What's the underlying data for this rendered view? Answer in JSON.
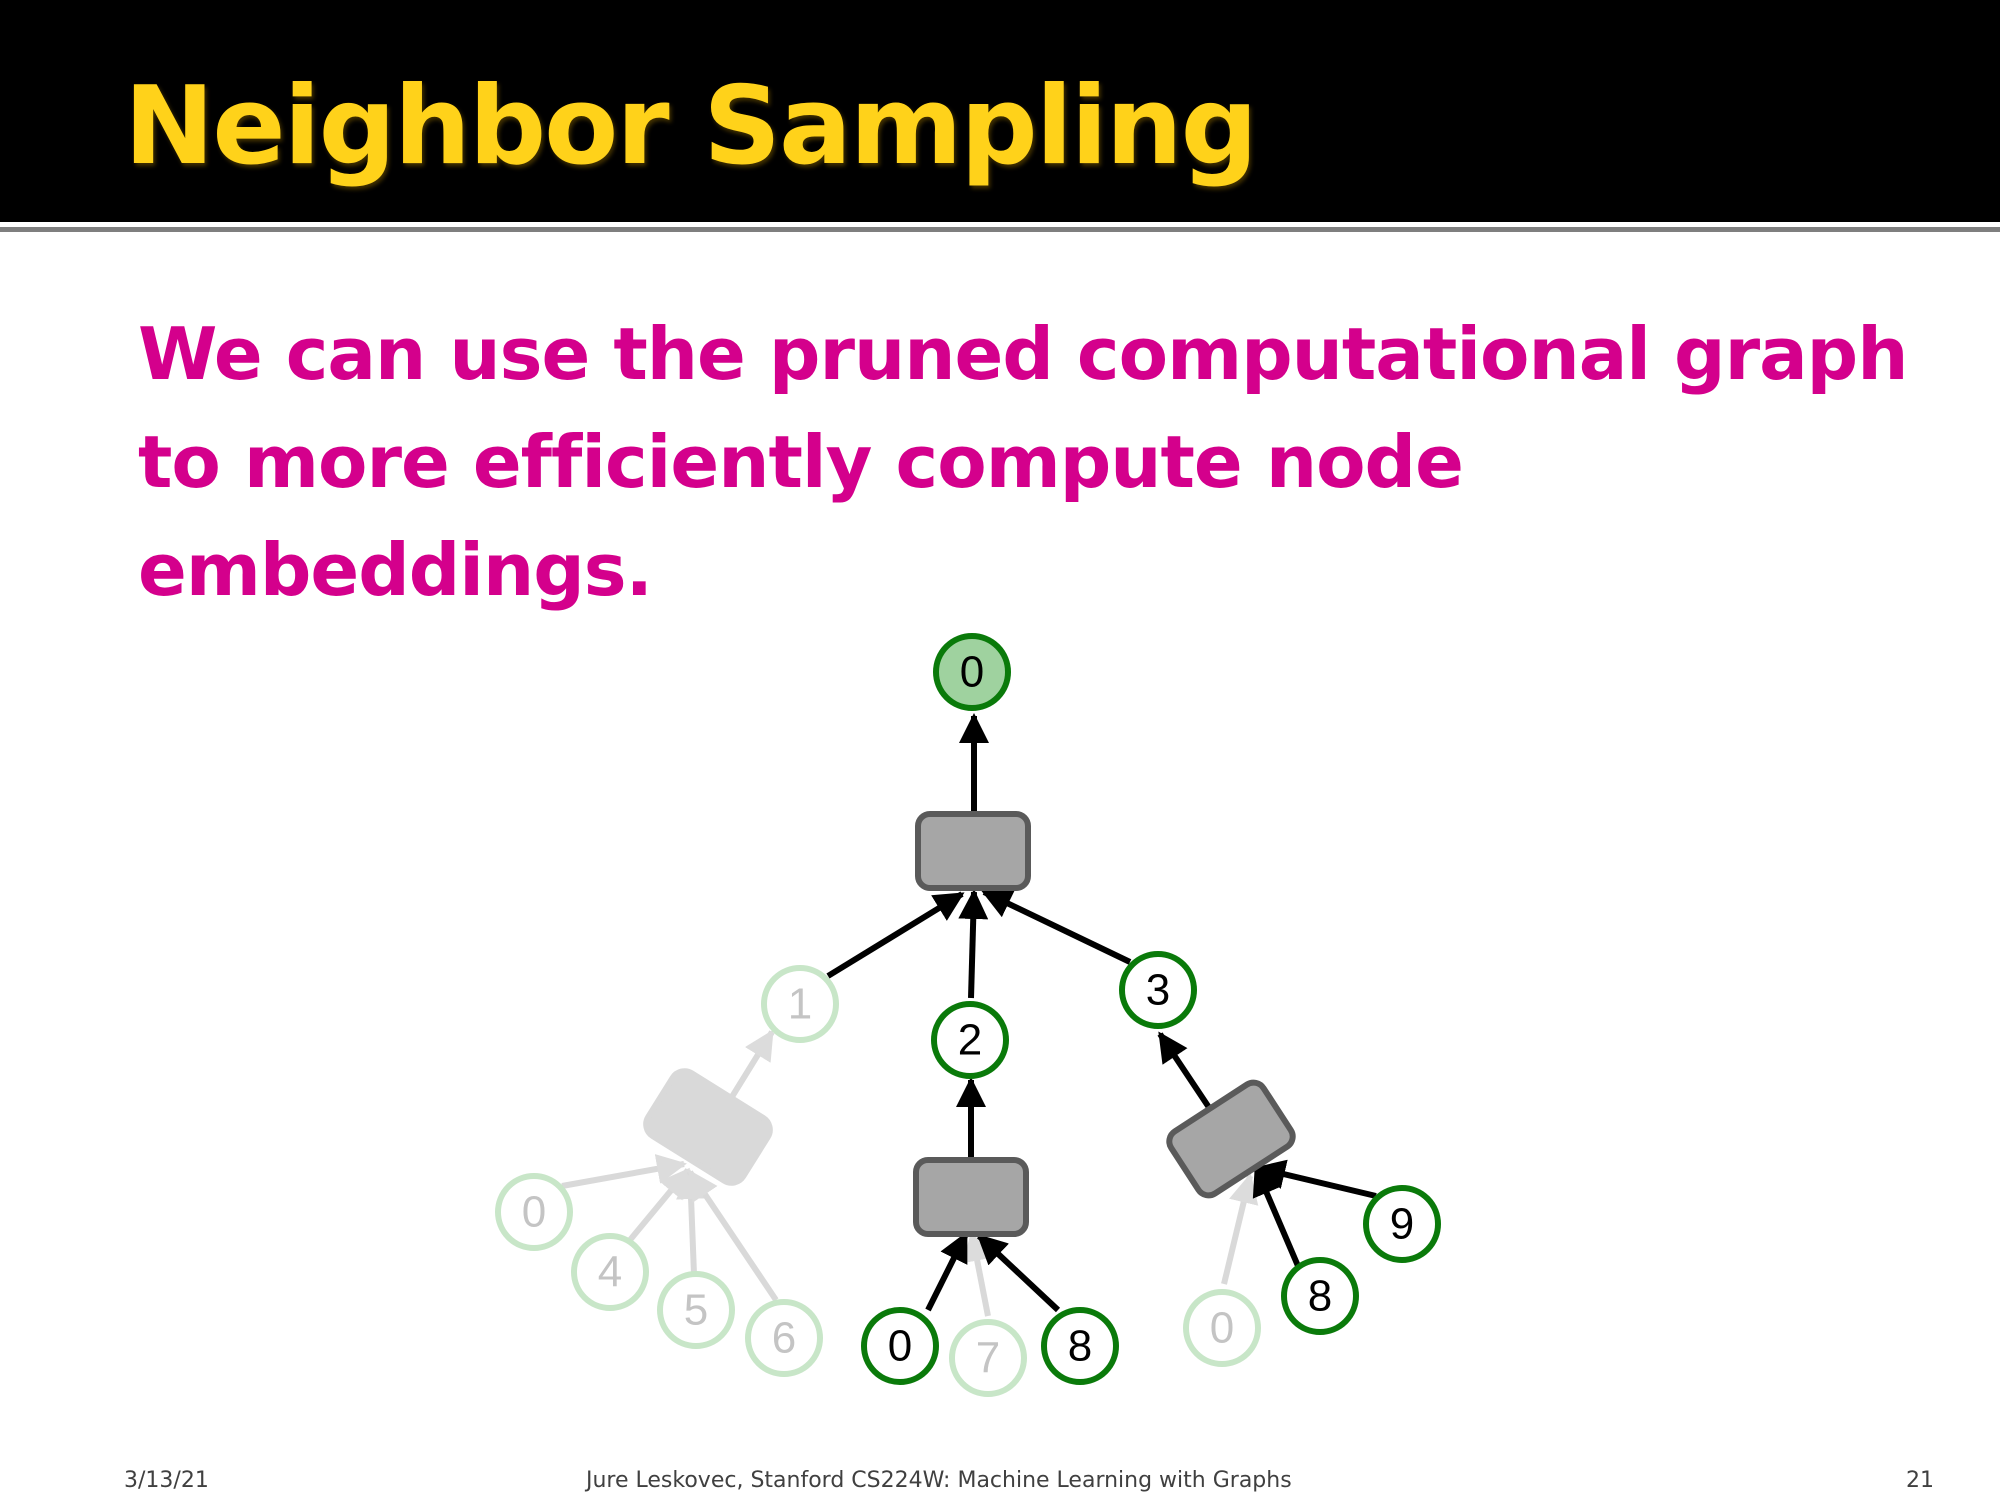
{
  "slide": {
    "title": "Neighbor Sampling",
    "body": "We can use the pruned computational graph to more efficiently compute node embeddings."
  },
  "diagram": {
    "colors": {
      "active_stroke": "#0a7a0a",
      "active_fill": "#ffffff",
      "root_fill": "#9fd29f",
      "faded_stroke": "#c8e6c8",
      "faded_text": "#c4c4c4",
      "box_fill": "#a6a6a6",
      "box_stroke": "#5a5a5a",
      "faded_box": "#d9d9d9",
      "edge": "#000000",
      "faded_edge": "#d9d9d9"
    },
    "nodes": {
      "root": "0",
      "layer1": [
        "1",
        "2",
        "3"
      ],
      "left_leaves": [
        "0",
        "4",
        "5",
        "6"
      ],
      "middle_leaves": [
        "0",
        "7",
        "8"
      ],
      "right_leaves": [
        "0",
        "8",
        "9"
      ]
    }
  },
  "footer": {
    "date": "3/13/21",
    "course": "Jure Leskovec, Stanford CS224W: Machine Learning with Graphs",
    "page": "21"
  }
}
